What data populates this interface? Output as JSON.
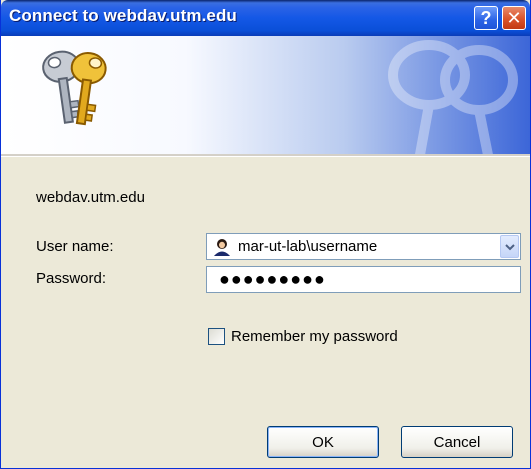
{
  "window": {
    "title": "Connect to webdav.utm.edu",
    "help_glyph": "?",
    "close_glyph": "✕"
  },
  "banner": {
    "keys_icon": "keys-icon"
  },
  "dialog": {
    "server": "webdav.utm.edu",
    "username_label": "User name:",
    "username_value": "mar-ut-lab\\username",
    "username_icon": "user-icon",
    "password_label": "Password:",
    "password_value": "●●●●●●●●●",
    "remember_label": "Remember my password",
    "remember_checked": false
  },
  "buttons": {
    "ok": "OK",
    "cancel": "Cancel"
  },
  "colors": {
    "titlebar": "#0a4fd8",
    "close_button": "#d9532a",
    "dialog_background": "#ece9d8"
  }
}
